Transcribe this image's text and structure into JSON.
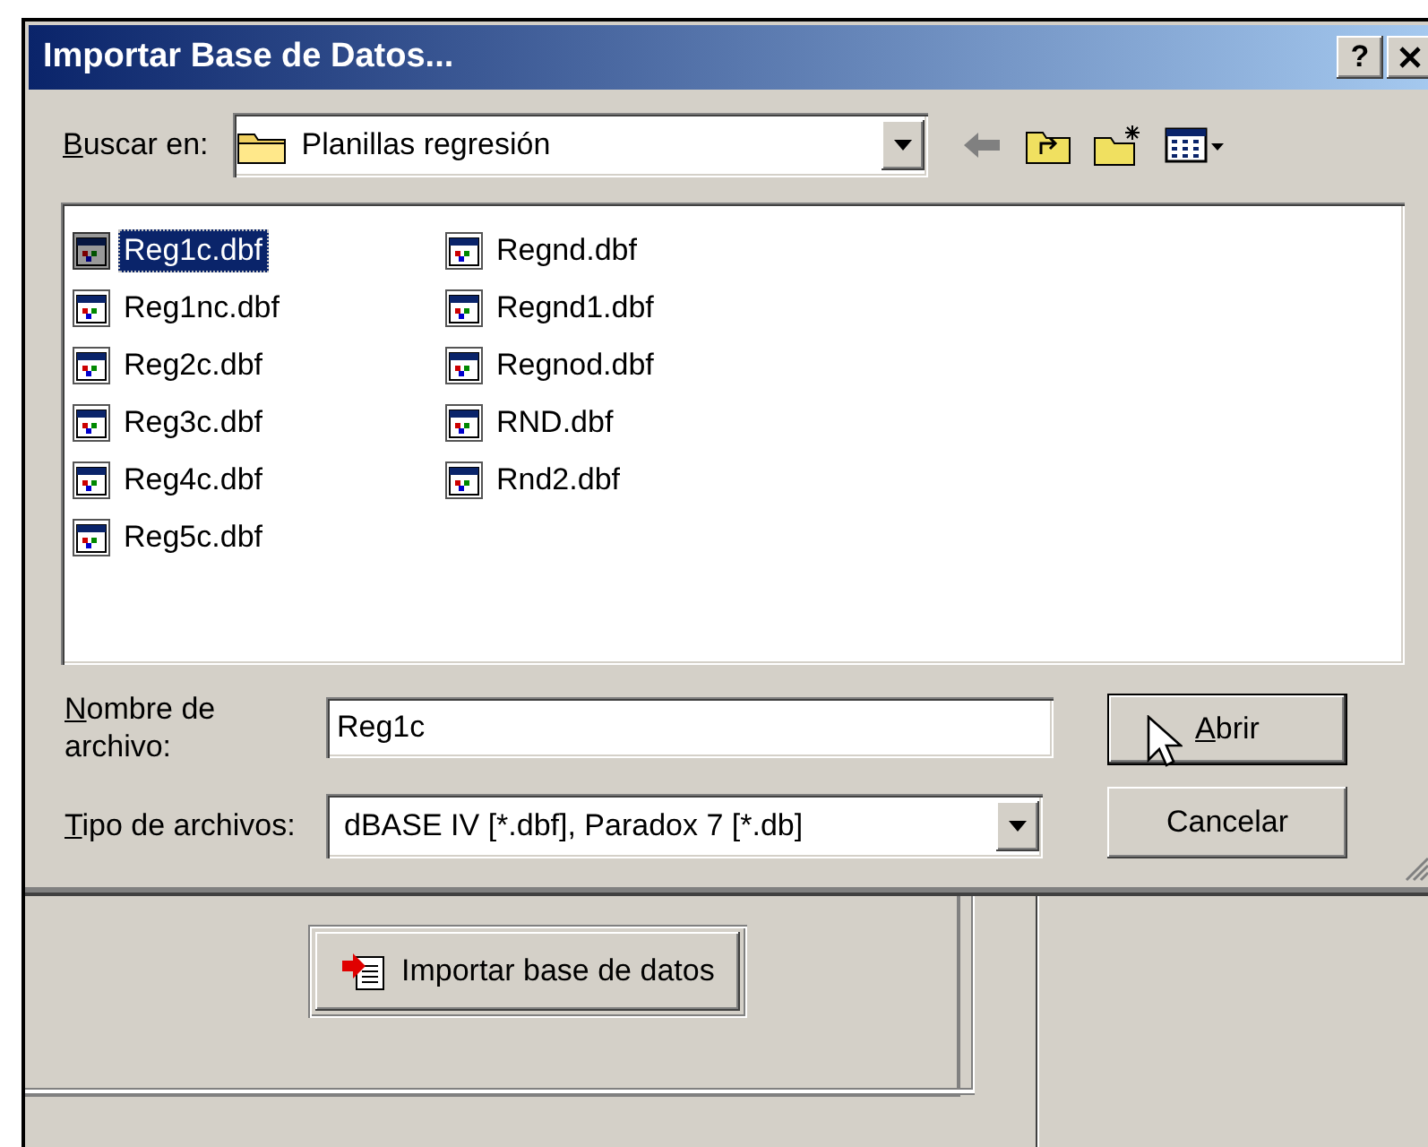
{
  "dialog": {
    "title": "Importar Base de Datos...",
    "help_button": "?",
    "look_in": {
      "label": "Buscar en:",
      "value": "Planillas regresión"
    },
    "files": [
      {
        "name": "Reg1c.dbf",
        "selected": true
      },
      {
        "name": "Reg1nc.dbf",
        "selected": false
      },
      {
        "name": "Reg2c.dbf",
        "selected": false
      },
      {
        "name": "Reg3c.dbf",
        "selected": false
      },
      {
        "name": "Reg4c.dbf",
        "selected": false
      },
      {
        "name": "Reg5c.dbf",
        "selected": false
      },
      {
        "name": "Regnd.dbf",
        "selected": false
      },
      {
        "name": "Regnd1.dbf",
        "selected": false
      },
      {
        "name": "Regnod.dbf",
        "selected": false
      },
      {
        "name": "RND.dbf",
        "selected": false
      },
      {
        "name": "Rnd2.dbf",
        "selected": false
      }
    ],
    "file_name": {
      "label": "Nombre de archivo:",
      "value": "Reg1c"
    },
    "file_type": {
      "label": "Tipo de archivos:",
      "value": "dBASE IV [*.dbf], Paradox 7 [*.db]"
    },
    "buttons": [
      {
        "label": "Abrir",
        "default": true
      },
      {
        "label": "Cancelar",
        "default": false
      }
    ]
  },
  "app": {
    "import_button": "Importar base de datos"
  }
}
